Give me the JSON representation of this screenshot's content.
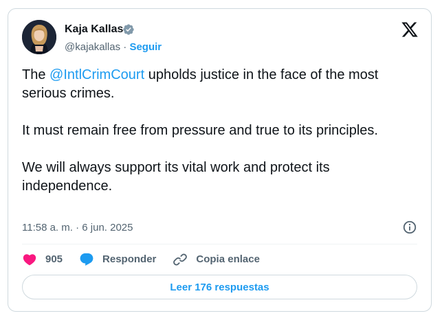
{
  "author": {
    "name": "Kaja Kallas",
    "handle": "@kajakallas",
    "separator": " · ",
    "follow_label": "Seguir",
    "verified_icon": "verified-badge-icon"
  },
  "tweet": {
    "p1_before": "The ",
    "p1_mention": "@IntlCrimCourt",
    "p1_after": " upholds justice in the face of the most serious crimes.",
    "p2": "It must remain free from pressure and true to its principles.",
    "p3": "We will always support its vital work and protect its independence."
  },
  "meta": {
    "timestamp": "11:58 a. m. · 6 jun. 2025"
  },
  "actions": {
    "likes": "905",
    "reply_label": "Responder",
    "copy_label": "Copia enlace"
  },
  "replies_button": "Leer 176 respuestas",
  "colors": {
    "accent": "#1d9bf0",
    "like": "#f91880",
    "text": "#0f1419",
    "muted": "#536471",
    "border": "#cfd9de"
  }
}
